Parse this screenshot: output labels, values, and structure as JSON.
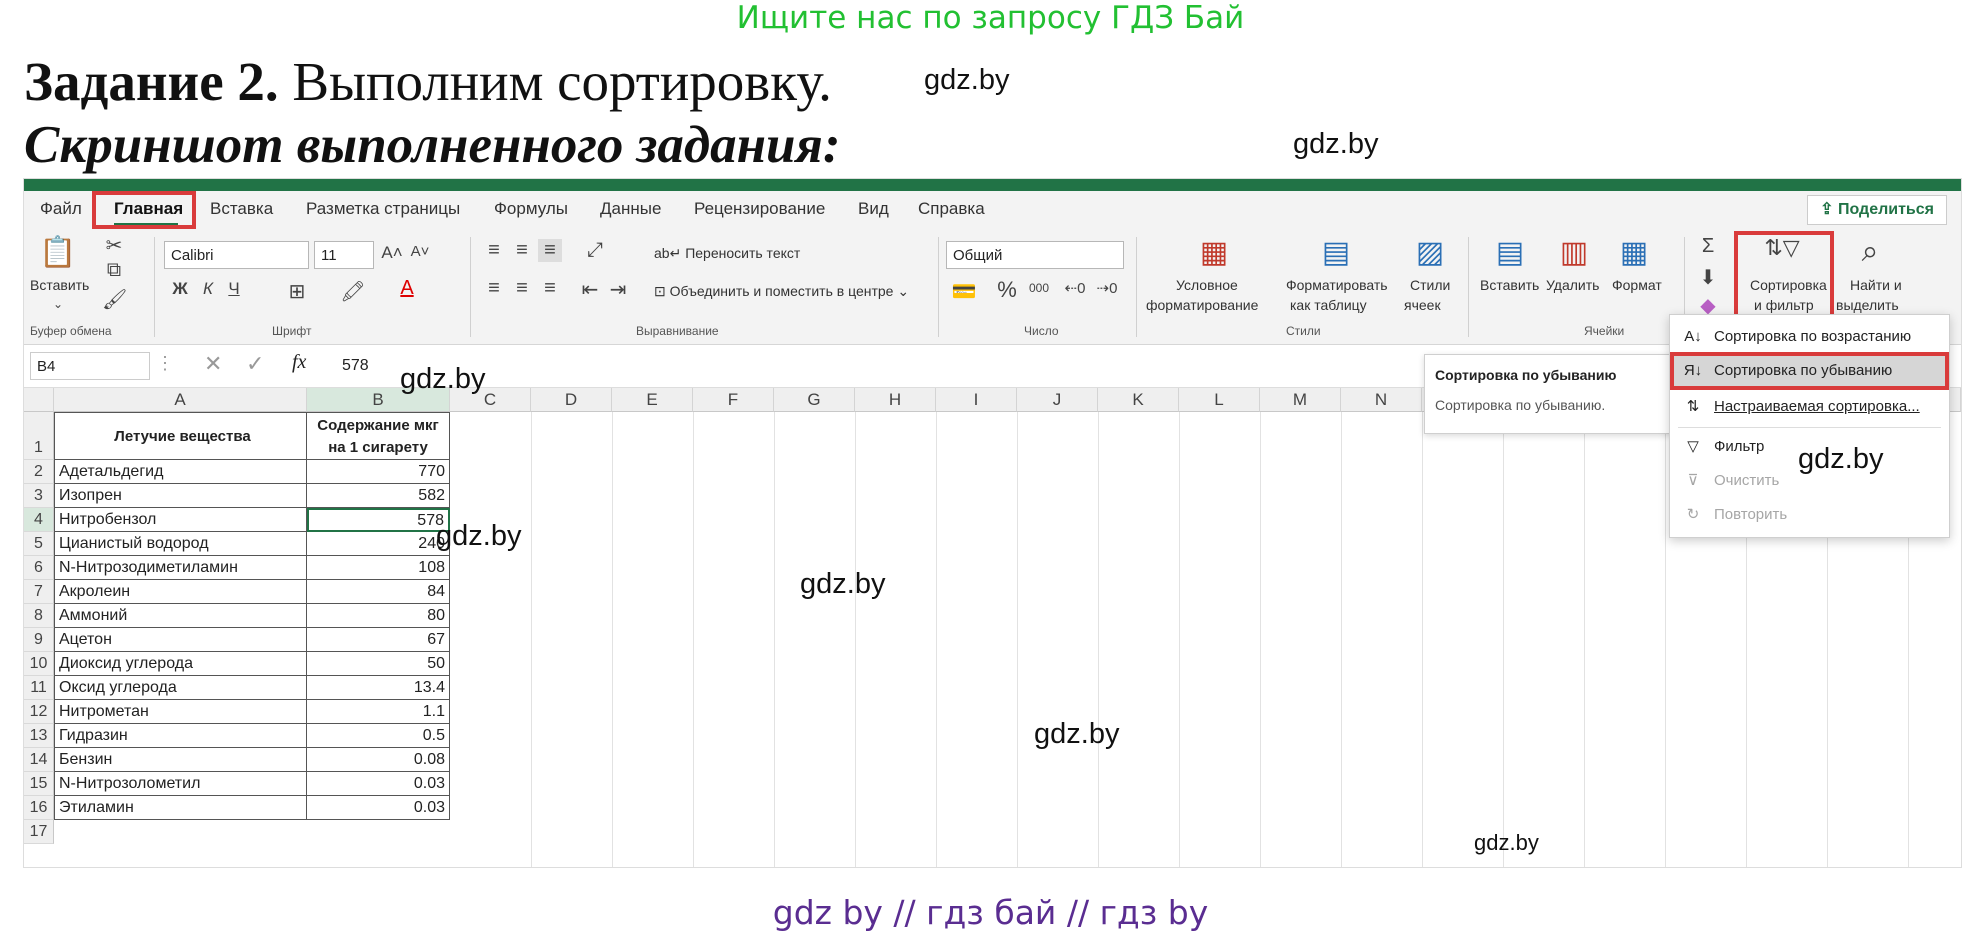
{
  "banner": "Ищите нас по запросу ГДЗ Бай",
  "task": {
    "label": "Задание 2.",
    "text": "Выполним сортировку."
  },
  "subtitle": "Скриншот выполненного задания:",
  "watermarks": [
    "gdz.by",
    "gdz.by",
    "gdz.by",
    "gdz.by",
    "gdz.by",
    "gdz.by",
    "gdz.by",
    "gdz.by"
  ],
  "footer": "gdz by  //  гдз бай  //  гдз by",
  "ribbon_tabs": [
    "Файл",
    "Главная",
    "Вставка",
    "Разметка страницы",
    "Формулы",
    "Данные",
    "Рецензирование",
    "Вид",
    "Справка"
  ],
  "share_label": "Поделиться",
  "clipboard": {
    "paste": "Вставить",
    "group": "Буфер обмена"
  },
  "font": {
    "name": "Calibri",
    "size": "11",
    "bold": "Ж",
    "italic": "К",
    "underline": "Ч",
    "group": "Шрифт"
  },
  "alignment": {
    "wrap": "Переносить текст",
    "merge": "Объединить и поместить в центре",
    "group": "Выравнивание"
  },
  "number": {
    "format": "Общий",
    "percent": "%",
    "thousands": "000",
    "group": "Число"
  },
  "styles": {
    "conditional_1": "Условное",
    "conditional_2": "форматирование",
    "format_table_1": "Форматировать",
    "format_table_2": "как таблицу",
    "cell_styles_1": "Стили",
    "cell_styles_2": "ячеек",
    "group": "Стили"
  },
  "cells": {
    "insert": "Вставить",
    "delete": "Удалить",
    "format": "Формат",
    "group": "Ячейки"
  },
  "editing": {
    "sort_1": "Сортировка",
    "sort_2": "и фильтр",
    "find_1": "Найти и",
    "find_2": "выделить"
  },
  "formula_bar": {
    "name_box": "B4",
    "fx": "fx",
    "value": "578"
  },
  "columns": [
    "A",
    "B",
    "C",
    "D",
    "E",
    "F",
    "G",
    "H",
    "I",
    "J",
    "K",
    "L",
    "M",
    "N"
  ],
  "header_row": {
    "a": "Летучие вещества",
    "b_1": "Содержание мкг",
    "b_2": "на 1 сигарету"
  },
  "rows": [
    {
      "name": "Адетальдегид",
      "value": "770"
    },
    {
      "name": "Изопрен",
      "value": "582"
    },
    {
      "name": "Нитробензол",
      "value": "578"
    },
    {
      "name": "Цианистый водород",
      "value": "240"
    },
    {
      "name": "N-Нитрозодиметиламин",
      "value": "108"
    },
    {
      "name": "Акролеин",
      "value": "84"
    },
    {
      "name": "Аммоний",
      "value": "80"
    },
    {
      "name": "Ацетон",
      "value": "67"
    },
    {
      "name": "Диоксид углерода",
      "value": "50"
    },
    {
      "name": "Оксид углерода",
      "value": "13.4"
    },
    {
      "name": "Нитрометан",
      "value": "1.1"
    },
    {
      "name": "Гидразин",
      "value": "0.5"
    },
    {
      "name": "Бензин",
      "value": "0.08"
    },
    {
      "name": "N-Нитрозолометил",
      "value": "0.03"
    },
    {
      "name": "Этиламин",
      "value": "0.03"
    }
  ],
  "row_numbers": [
    "1",
    "2",
    "3",
    "4",
    "5",
    "6",
    "7",
    "8",
    "9",
    "10",
    "11",
    "12",
    "13",
    "14",
    "15",
    "16",
    "17"
  ],
  "tooltip": {
    "title": "Сортировка по убыванию",
    "desc": "Сортировка по убыванию."
  },
  "sort_menu": [
    {
      "label": "Сортировка по возрастанию",
      "icon": "sort-asc-icon",
      "disabled": false
    },
    {
      "label": "Сортировка по убыванию",
      "icon": "sort-desc-icon",
      "disabled": false
    },
    {
      "label": "Настраиваемая сортировка...",
      "icon": "custom-sort-icon",
      "disabled": false
    },
    {
      "label": "Фильтр",
      "icon": "filter-icon",
      "disabled": false
    },
    {
      "label": "Очистить",
      "icon": "clear-filter-icon",
      "disabled": true
    },
    {
      "label": "Повторить",
      "icon": "reapply-icon",
      "disabled": true
    }
  ],
  "colors": {
    "excel_green": "#217346",
    "highlight_red": "#d93b3b",
    "banner_green": "#22c032",
    "footer_purple": "#5a2d91"
  }
}
